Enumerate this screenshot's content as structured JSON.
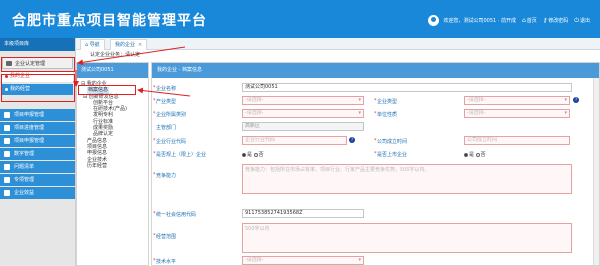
{
  "header": {
    "title": "合肥市重点项目智能管理平台",
    "welcome": "欢迎您，测试公司0051 · 前开成",
    "links": [
      {
        "icon": "home-icon",
        "label": "首页"
      },
      {
        "icon": "key-icon",
        "label": "修改密码"
      },
      {
        "icon": "logout-icon",
        "label": "退出"
      }
    ]
  },
  "sidebar": {
    "title": "本级项目库",
    "active_group": "企业认定管理",
    "sub_items": [
      {
        "label": "我的企业"
      },
      {
        "label": "我的经营"
      }
    ],
    "groups": [
      {
        "label": "项目申报管理"
      },
      {
        "label": "项目进度管理"
      },
      {
        "label": "项目申报管理"
      },
      {
        "label": "数字管理"
      },
      {
        "label": "问题清单"
      },
      {
        "label": "专项管理"
      },
      {
        "label": "企业效益"
      }
    ]
  },
  "tabs": [
    {
      "label": "导航"
    },
    {
      "label": "我的企业"
    }
  ],
  "breadcrumb": "认定企业业务：请认定",
  "tree_panel": {
    "title": "测试公司0051",
    "nodes": [
      {
        "label": "我的企业",
        "level": 0
      },
      {
        "label": "档案信息",
        "level": 1
      },
      {
        "label": "创新研发信息",
        "level": 1
      },
      {
        "label": "创新平台",
        "level": 2
      },
      {
        "label": "在研技术(产品)",
        "level": 2
      },
      {
        "label": "发明专利",
        "level": 2
      },
      {
        "label": "行业标准",
        "level": 2
      },
      {
        "label": "成果奖励",
        "level": 2
      },
      {
        "label": "品牌认定",
        "level": 2
      },
      {
        "label": "产品信息",
        "level": 1
      },
      {
        "label": "项目信息",
        "level": 1
      },
      {
        "label": "申报信息",
        "level": 1
      },
      {
        "label": "企业技术",
        "level": 1
      },
      {
        "label": "历年经营",
        "level": 1
      }
    ]
  },
  "form": {
    "title": "我的企业 - 档案信息",
    "company_name_label": "企业名称",
    "company_name_value": "测试公司0051",
    "industry_label": "产业类型",
    "industry_value": "-请选择-",
    "company_type_label": "企业类型",
    "company_type_value": "-请选择-",
    "region_label": "企业所属类别",
    "region_value": "-请选择-",
    "unit_level_label": "单位性质",
    "unit_level_value": "-请选择-",
    "dept_label": "主管部门",
    "dept_value": "高新区",
    "code_label": "企业行业代码",
    "code_placeholder": "企业行业代码",
    "reg_time_label": "公司成立时间",
    "reg_time_placeholder": "公司成立时间",
    "above_scale_label": "是否规上（限上）企业",
    "listed_label": "是否上市企业",
    "radio_yes": "是",
    "radio_no": "否",
    "competitiveness_label": "竞争能力",
    "competitiveness_placeholder": "竞争能力：包括所在市场占有率、项目行业、行家产品主要竞争优势，500字以内。",
    "credit_code_label": "统一社会信用代码",
    "credit_code_value": "91175385274193568Z",
    "scope_label": "经营范围",
    "scope_placeholder": "500字以内",
    "tech_level_label": "技术水平",
    "tech_level_value": "-请选择-",
    "help_mark": "?"
  }
}
